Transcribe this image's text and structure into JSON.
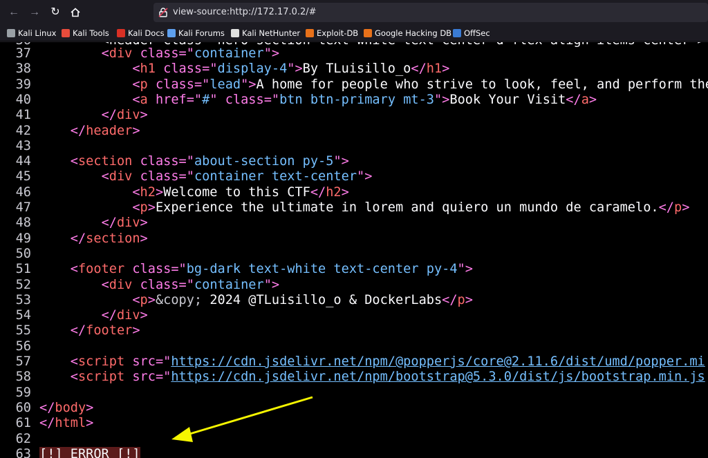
{
  "browser": {
    "url": "view-source:http://172.17.0.2/#"
  },
  "bookmarks": [
    {
      "label": "Kali Linux",
      "color": "#9aa0a6"
    },
    {
      "label": "Kali Tools",
      "color": "#e74c3c"
    },
    {
      "label": "Kali Docs",
      "color": "#d93025"
    },
    {
      "label": "Kali Forums",
      "color": "#5ea0ef"
    },
    {
      "label": "Kali NetHunter",
      "color": "#e0e0e0"
    },
    {
      "label": "Exploit-DB",
      "color": "#e8711a"
    },
    {
      "label": "Google Hacking DB",
      "color": "#e8711a"
    },
    {
      "label": "OffSec",
      "color": "#3a7bd5"
    }
  ],
  "source": {
    "top_partial": "        <header class=\"hero-section text-white text-center d-flex align-items-center\">",
    "lines": [
      {
        "n": "37",
        "indent": "        ",
        "parts": [
          [
            "tag",
            "<"
          ],
          [
            "tn",
            "div"
          ],
          [
            "tag",
            " "
          ],
          [
            "an",
            "class"
          ],
          [
            "tag",
            "=\""
          ],
          [
            "av",
            "container"
          ],
          [
            "tag",
            "\">"
          ]
        ]
      },
      {
        "n": "38",
        "indent": "            ",
        "parts": [
          [
            "tag",
            "<"
          ],
          [
            "tn",
            "h1"
          ],
          [
            "tag",
            " "
          ],
          [
            "an",
            "class"
          ],
          [
            "tag",
            "=\""
          ],
          [
            "av",
            "display-4"
          ],
          [
            "tag",
            "\">"
          ],
          [
            "txt",
            "By TLuisillo_o"
          ],
          [
            "tag",
            "</"
          ],
          [
            "tn",
            "h1"
          ],
          [
            "tag",
            ">"
          ]
        ]
      },
      {
        "n": "39",
        "indent": "            ",
        "parts": [
          [
            "tag",
            "<"
          ],
          [
            "tn",
            "p"
          ],
          [
            "tag",
            " "
          ],
          [
            "an",
            "class"
          ],
          [
            "tag",
            "=\""
          ],
          [
            "av",
            "lead"
          ],
          [
            "tag",
            "\">"
          ],
          [
            "txt",
            "A home for people who strive to look, feel, and perform their b"
          ]
        ]
      },
      {
        "n": "40",
        "indent": "            ",
        "parts": [
          [
            "tag",
            "<"
          ],
          [
            "tn",
            "a"
          ],
          [
            "tag",
            " "
          ],
          [
            "an",
            "href"
          ],
          [
            "tag",
            "=\""
          ],
          [
            "av",
            "#"
          ],
          [
            "tag",
            "\" "
          ],
          [
            "an",
            "class"
          ],
          [
            "tag",
            "=\""
          ],
          [
            "av",
            "btn btn-primary mt-3"
          ],
          [
            "tag",
            "\">"
          ],
          [
            "txt",
            "Book Your Visit"
          ],
          [
            "tag",
            "</"
          ],
          [
            "tn",
            "a"
          ],
          [
            "tag",
            ">"
          ]
        ]
      },
      {
        "n": "41",
        "indent": "        ",
        "parts": [
          [
            "tag",
            "</"
          ],
          [
            "tn",
            "div"
          ],
          [
            "tag",
            ">"
          ]
        ]
      },
      {
        "n": "42",
        "indent": "    ",
        "parts": [
          [
            "tag",
            "</"
          ],
          [
            "tn",
            "header"
          ],
          [
            "tag",
            ">"
          ]
        ]
      },
      {
        "n": "43",
        "indent": "",
        "parts": []
      },
      {
        "n": "44",
        "indent": "    ",
        "parts": [
          [
            "tag",
            "<"
          ],
          [
            "tn",
            "section"
          ],
          [
            "tag",
            " "
          ],
          [
            "an",
            "class"
          ],
          [
            "tag",
            "=\""
          ],
          [
            "av",
            "about-section py-5"
          ],
          [
            "tag",
            "\">"
          ]
        ]
      },
      {
        "n": "45",
        "indent": "        ",
        "parts": [
          [
            "tag",
            "<"
          ],
          [
            "tn",
            "div"
          ],
          [
            "tag",
            " "
          ],
          [
            "an",
            "class"
          ],
          [
            "tag",
            "=\""
          ],
          [
            "av",
            "container text-center"
          ],
          [
            "tag",
            "\">"
          ]
        ]
      },
      {
        "n": "46",
        "indent": "            ",
        "parts": [
          [
            "tag",
            "<"
          ],
          [
            "tn",
            "h2"
          ],
          [
            "tag",
            ">"
          ],
          [
            "txt",
            "Welcome to this CTF"
          ],
          [
            "tag",
            "</"
          ],
          [
            "tn",
            "h2"
          ],
          [
            "tag",
            ">"
          ]
        ]
      },
      {
        "n": "47",
        "indent": "            ",
        "parts": [
          [
            "tag",
            "<"
          ],
          [
            "tn",
            "p"
          ],
          [
            "tag",
            ">"
          ],
          [
            "txt",
            "Experience the ultimate in lorem and quiero un mundo de caramelo."
          ],
          [
            "tag",
            "</"
          ],
          [
            "tn",
            "p"
          ],
          [
            "tag",
            ">"
          ]
        ]
      },
      {
        "n": "48",
        "indent": "        ",
        "parts": [
          [
            "tag",
            "</"
          ],
          [
            "tn",
            "div"
          ],
          [
            "tag",
            ">"
          ]
        ]
      },
      {
        "n": "49",
        "indent": "    ",
        "parts": [
          [
            "tag",
            "</"
          ],
          [
            "tn",
            "section"
          ],
          [
            "tag",
            ">"
          ]
        ]
      },
      {
        "n": "50",
        "indent": "",
        "parts": []
      },
      {
        "n": "51",
        "indent": "    ",
        "parts": [
          [
            "tag",
            "<"
          ],
          [
            "tn",
            "footer"
          ],
          [
            "tag",
            " "
          ],
          [
            "an",
            "class"
          ],
          [
            "tag",
            "=\""
          ],
          [
            "av",
            "bg-dark text-white text-center py-4"
          ],
          [
            "tag",
            "\">"
          ]
        ]
      },
      {
        "n": "52",
        "indent": "        ",
        "parts": [
          [
            "tag",
            "<"
          ],
          [
            "tn",
            "div"
          ],
          [
            "tag",
            " "
          ],
          [
            "an",
            "class"
          ],
          [
            "tag",
            "=\""
          ],
          [
            "av",
            "container"
          ],
          [
            "tag",
            "\">"
          ]
        ]
      },
      {
        "n": "53",
        "indent": "            ",
        "parts": [
          [
            "tag",
            "<"
          ],
          [
            "tn",
            "p"
          ],
          [
            "tag",
            ">"
          ],
          [
            "ent",
            "&copy;"
          ],
          [
            "txt",
            " 2024 @TLuisillo_o & DockerLabs"
          ],
          [
            "tag",
            "</"
          ],
          [
            "tn",
            "p"
          ],
          [
            "tag",
            ">"
          ]
        ]
      },
      {
        "n": "54",
        "indent": "        ",
        "parts": [
          [
            "tag",
            "</"
          ],
          [
            "tn",
            "div"
          ],
          [
            "tag",
            ">"
          ]
        ]
      },
      {
        "n": "55",
        "indent": "    ",
        "parts": [
          [
            "tag",
            "</"
          ],
          [
            "tn",
            "footer"
          ],
          [
            "tag",
            ">"
          ]
        ]
      },
      {
        "n": "56",
        "indent": "",
        "parts": []
      },
      {
        "n": "57",
        "indent": "    ",
        "parts": [
          [
            "tag",
            "<"
          ],
          [
            "tn",
            "script"
          ],
          [
            "tag",
            " "
          ],
          [
            "an",
            "src"
          ],
          [
            "tag",
            "=\""
          ],
          [
            "lnk",
            "https://cdn.jsdelivr.net/npm/@popperjs/core@2.11.6/dist/umd/popper.mi"
          ]
        ]
      },
      {
        "n": "58",
        "indent": "    ",
        "parts": [
          [
            "tag",
            "<"
          ],
          [
            "tn",
            "script"
          ],
          [
            "tag",
            " "
          ],
          [
            "an",
            "src"
          ],
          [
            "tag",
            "=\""
          ],
          [
            "lnk",
            "https://cdn.jsdelivr.net/npm/bootstrap@5.3.0/dist/js/bootstrap.min.js"
          ]
        ]
      },
      {
        "n": "59",
        "indent": "",
        "parts": []
      },
      {
        "n": "60",
        "indent": "",
        "parts": [
          [
            "tag",
            "</"
          ],
          [
            "tn",
            "body"
          ],
          [
            "tag",
            ">"
          ]
        ]
      },
      {
        "n": "61",
        "indent": "",
        "parts": [
          [
            "tag",
            "</"
          ],
          [
            "tn",
            "html"
          ],
          [
            "tag",
            ">"
          ]
        ]
      },
      {
        "n": "62",
        "indent": "",
        "parts": []
      },
      {
        "n": "63",
        "indent": "",
        "parts": [
          [
            "err",
            "[!] ERROR [!]"
          ]
        ]
      }
    ]
  },
  "annotation": {
    "arrow_color": "#f5f500"
  }
}
